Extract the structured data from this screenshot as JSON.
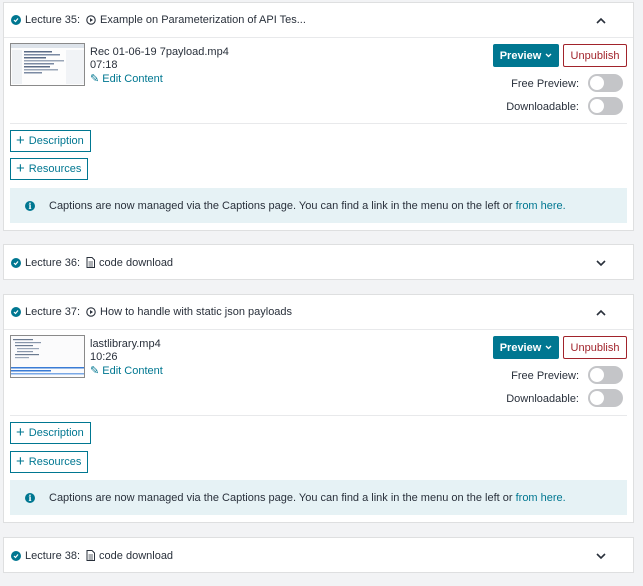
{
  "lectures": [
    {
      "number": "Lecture 35:",
      "title": "Example on Parameterization of API Tes...",
      "type_icon": "play-circle-icon",
      "open": true,
      "video": {
        "filename": "Rec 01-06-19 7payload.mp4",
        "duration": "07:18"
      },
      "edit_label": "Edit Content"
    },
    {
      "number": "Lecture 36:",
      "title": "code download",
      "type_icon": "file-icon",
      "open": false
    },
    {
      "number": "Lecture 37:",
      "title": "How to handle with static json payloads",
      "type_icon": "play-circle-icon",
      "open": true,
      "video": {
        "filename": "lastlibrary.mp4",
        "duration": "10:26"
      },
      "edit_label": "Edit Content"
    },
    {
      "number": "Lecture 38:",
      "title": "code download",
      "type_icon": "file-icon",
      "open": false
    }
  ],
  "labels": {
    "preview": "Preview",
    "unpublish": "Unpublish",
    "free_preview": "Free Preview:",
    "downloadable": "Downloadable:",
    "description": "Description",
    "resources": "Resources",
    "captions_text": "Captions are now managed via the Captions page. You can find a link in the menu on the left or",
    "captions_link": "from here."
  },
  "colors": {
    "accent": "#007791",
    "unpublish": "#a1232b",
    "info_bg": "#e6f2f5"
  }
}
